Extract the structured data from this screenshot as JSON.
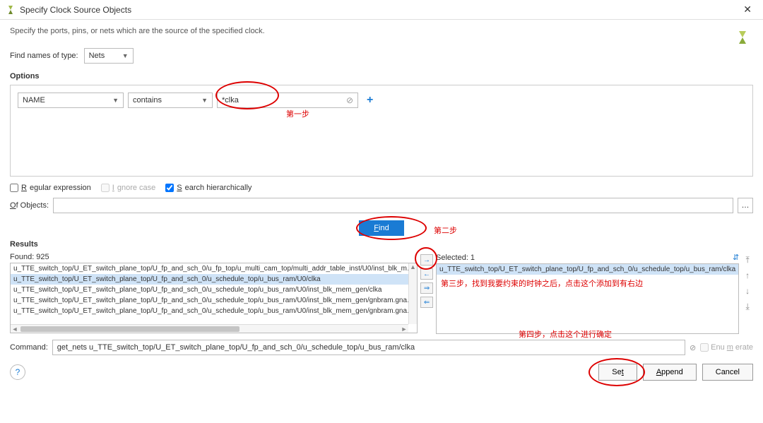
{
  "window": {
    "title": "Specify Clock Source Objects",
    "subtitle": "Specify the ports, pins, or nets which are the source of the specified clock."
  },
  "find_names": {
    "label": "Find names of type:",
    "value": "Nets"
  },
  "options": {
    "section_label": "Options",
    "attr": "NAME",
    "match": "contains",
    "pattern": "*clka",
    "annot_step1": "第一步"
  },
  "checks": {
    "regex": {
      "label": "Regular expression",
      "checked": false,
      "enabled": true
    },
    "ignorecase": {
      "label": "Ignore case",
      "checked": false,
      "enabled": false
    },
    "hier": {
      "label": "Search hierarchically",
      "checked": true,
      "enabled": true
    }
  },
  "of_objects_label": "Of Objects:",
  "find": {
    "label": "Find",
    "annot_step2": "第二步"
  },
  "results": {
    "section_label": "Results",
    "found_label": "Found: 925",
    "selected_label": "Selected: 1",
    "found": [
      "u_TTE_switch_top/U_ET_switch_plane_top/U_fp_and_sch_0/u_fp_top/u_multi_cam_top/multi_addr_table_inst/U0/inst_blk_m…",
      "u_TTE_switch_top/U_ET_switch_plane_top/U_fp_and_sch_0/u_schedule_top/u_bus_ram/U0/clka",
      "u_TTE_switch_top/U_ET_switch_plane_top/U_fp_and_sch_0/u_schedule_top/u_bus_ram/U0/inst_blk_mem_gen/clka",
      "u_TTE_switch_top/U_ET_switch_plane_top/U_fp_and_sch_0/u_schedule_top/u_bus_ram/U0/inst_blk_mem_gen/gnbram.gna…",
      "u_TTE_switch_top/U_ET_switch_plane_top/U_fp_and_sch_0/u_schedule_top/u_bus_ram/U0/inst_blk_mem_gen/gnbram.gna…"
    ],
    "selected_item": "u_TTE_switch_top/U_ET_switch_plane_top/U_fp_and_sch_0/u_schedule_top/u_bus_ram/clka",
    "annot_step3": "第三步，找到我要约束的时钟之后，点击这个添加到有右边"
  },
  "command": {
    "label": "Command:",
    "value": "get_nets u_TTE_switch_top/U_ET_switch_plane_top/U_fp_and_sch_0/u_schedule_top/u_bus_ram/clka",
    "enumerate_label": "Enumerate"
  },
  "footer": {
    "annot_step4": "第四步，点击这个进行确定",
    "set": "Set",
    "append": "Append",
    "cancel": "Cancel"
  }
}
